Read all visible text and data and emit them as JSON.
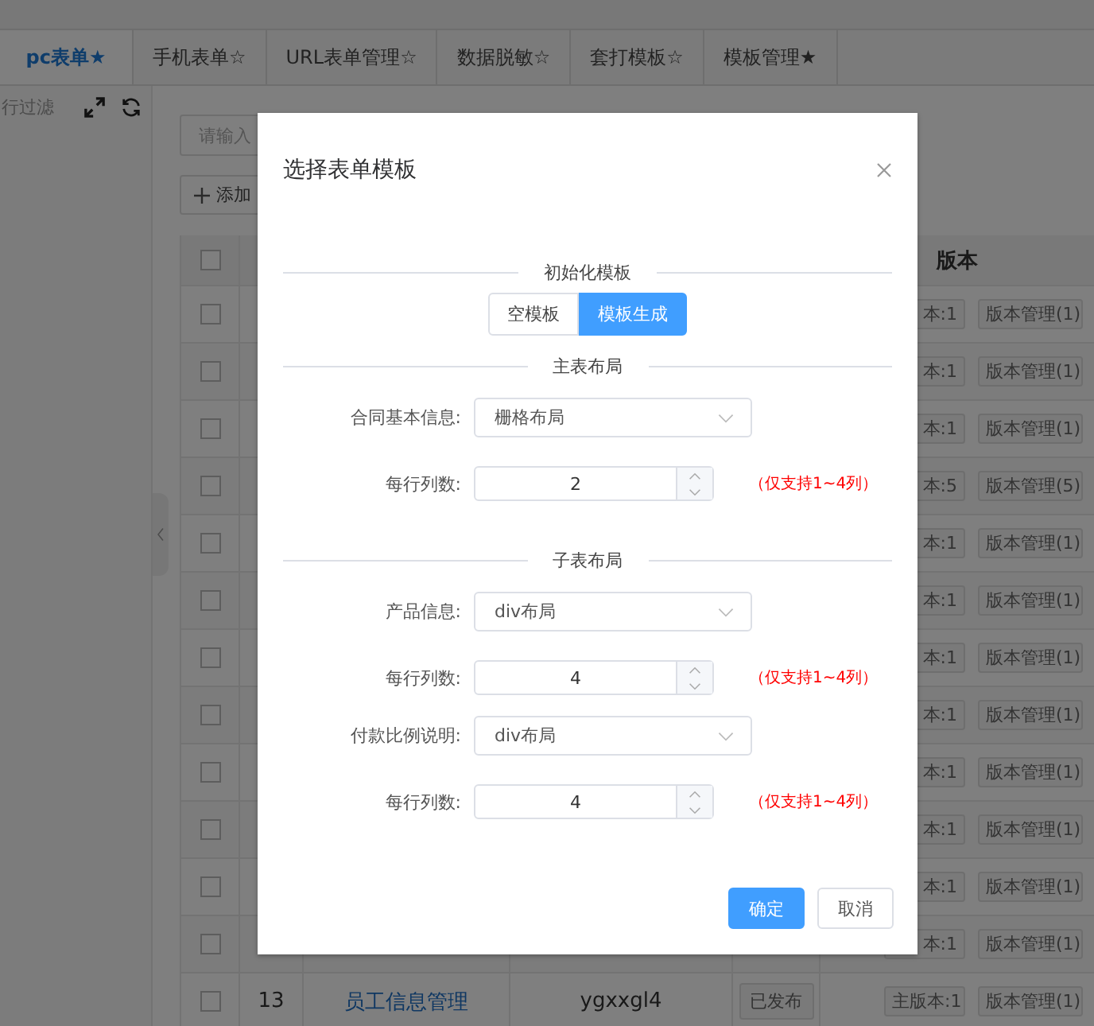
{
  "tabs": [
    {
      "label": "pc表单★",
      "selected": true
    },
    {
      "label": "手机表单☆",
      "selected": false
    },
    {
      "label": "URL表单管理☆",
      "selected": false
    },
    {
      "label": "数据脱敏☆",
      "selected": false
    },
    {
      "label": "套打模板☆",
      "selected": false
    },
    {
      "label": "模板管理★",
      "selected": false
    }
  ],
  "left_panel": {
    "filter_label": "行过滤"
  },
  "toolbar": {
    "search_placeholder": "请输入",
    "add_button": "添加"
  },
  "table": {
    "all_checked": false,
    "version_header": "版本",
    "rows": [
      {
        "checked": false,
        "version": "本:1",
        "manage": "版本管理(1)"
      },
      {
        "checked": false,
        "version": "本:1",
        "manage": "版本管理(1)"
      },
      {
        "checked": false,
        "version": "本:1",
        "manage": "版本管理(1)"
      },
      {
        "checked": false,
        "version": "本:5",
        "manage": "版本管理(5)"
      },
      {
        "checked": false,
        "version": "本:1",
        "manage": "版本管理(1)"
      },
      {
        "checked": false,
        "version": "本:1",
        "manage": "版本管理(1)"
      },
      {
        "checked": false,
        "version": "本:1",
        "manage": "版本管理(1)"
      },
      {
        "checked": false,
        "version": "本:1",
        "manage": "版本管理(1)"
      },
      {
        "checked": false,
        "version": "本:1",
        "manage": "版本管理(1)"
      },
      {
        "checked": false,
        "version": "本:1",
        "manage": "版本管理(1)"
      },
      {
        "checked": false,
        "version": "本:1",
        "manage": "版本管理(1)"
      },
      {
        "checked": false,
        "version": "本:1",
        "manage": "版本管理(1)"
      },
      {
        "checked": false,
        "index": "13",
        "name": "员工信息管理",
        "code": "ygxxgl4",
        "status": "已发布",
        "version": "主版本:1",
        "manage": "版本管理(1)"
      }
    ]
  },
  "dialog": {
    "title": "选择表单模板",
    "sections": [
      {
        "kind": "choice",
        "title": "初始化模板",
        "options": [
          {
            "label": "空模板",
            "selected": false
          },
          {
            "label": "模板生成",
            "selected": true
          }
        ]
      },
      {
        "kind": "fields",
        "title": "主表布局",
        "fields": [
          {
            "kind": "select",
            "label": "合同基本信息:",
            "value": "栅格布局"
          },
          {
            "kind": "number",
            "label": "每行列数:",
            "value": "2",
            "hint": "（仅支持1~4列）"
          }
        ]
      },
      {
        "kind": "fields",
        "title": "子表布局",
        "fields": [
          {
            "kind": "select",
            "label": "产品信息:",
            "value": "div布局"
          },
          {
            "kind": "number",
            "label": "每行列数:",
            "value": "4",
            "hint": "（仅支持1~4列）"
          },
          {
            "kind": "select",
            "label": "付款比例说明:",
            "value": "div布局"
          },
          {
            "kind": "number",
            "label": "每行列数:",
            "value": "4",
            "hint": "（仅支持1~4列）"
          }
        ]
      }
    ],
    "buttons": [
      {
        "label": "确定",
        "primary": true
      },
      {
        "label": "取消",
        "primary": false
      }
    ]
  }
}
